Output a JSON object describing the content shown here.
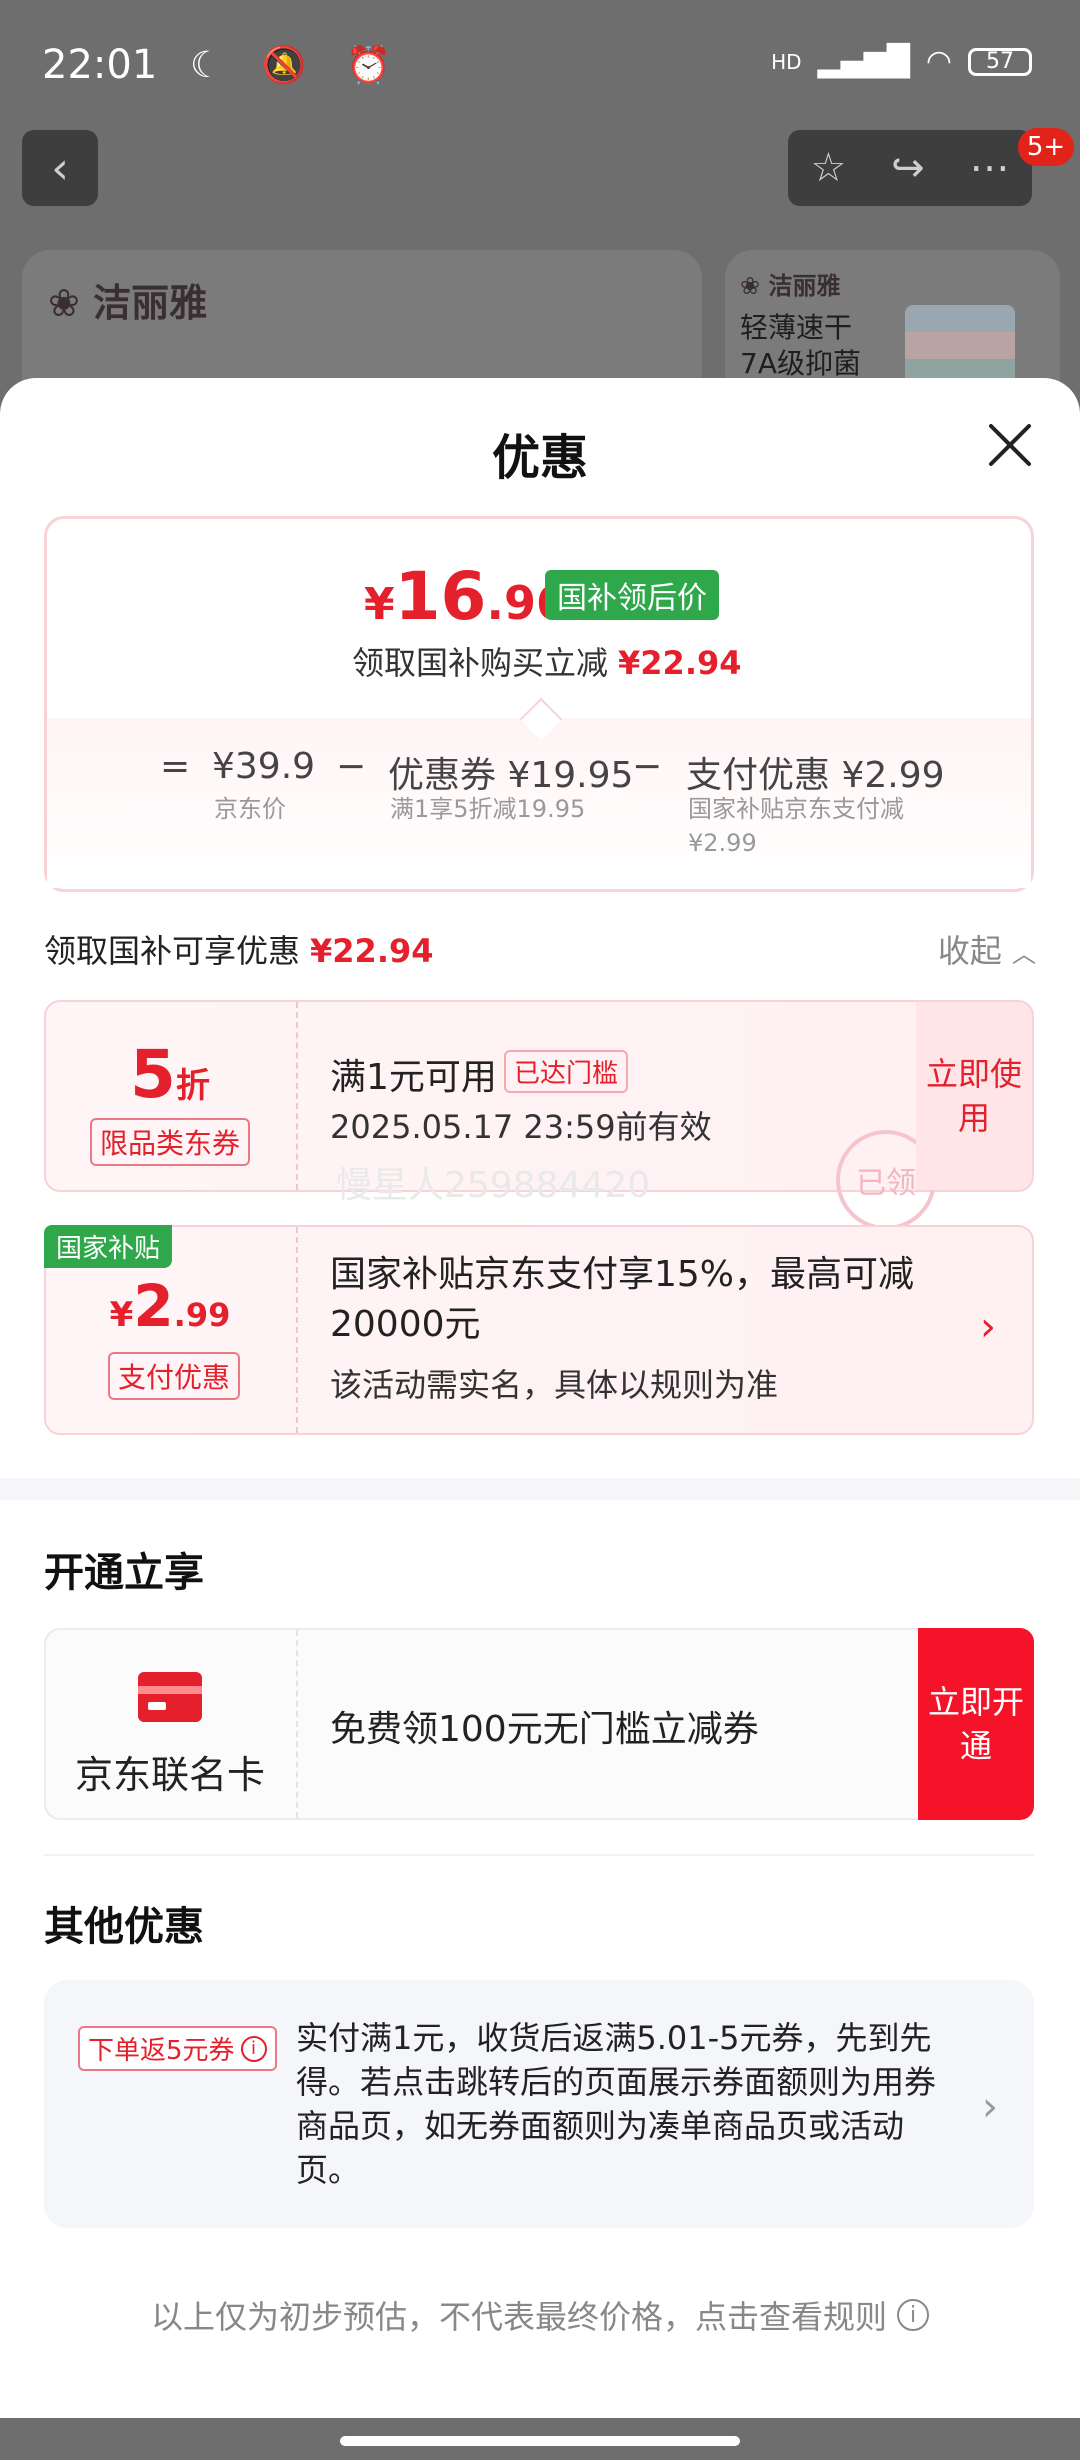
{
  "status_bar": {
    "time": "22:01",
    "left_icons": "☾ 🔕 ⏰",
    "network": "HD",
    "battery": "57"
  },
  "background": {
    "brand1": "洁丽雅",
    "brand2": "洁丽雅",
    "product_line1": "轻薄速干",
    "product_line2": "7A级抑菌",
    "badge": "5+"
  },
  "sheet": {
    "title": "优惠",
    "summary": {
      "currency": "¥",
      "price_int": "16",
      "price_dec": ".96",
      "price_tag": "国补领后价",
      "claim_text": "领取国补购买立减",
      "claim_amount": "¥22.94",
      "formula": {
        "eq": "=",
        "base_price": "¥39.9",
        "base_label": "京东价",
        "minus1": "−",
        "coupon_label": "优惠券 ¥19.95",
        "coupon_sub": "满1享5折减19.95",
        "minus2": "−",
        "pay_label": "支付优惠 ¥2.99",
        "pay_sub": "国家补贴京东支付减¥2.99"
      }
    },
    "section": {
      "title": "领取国补可享优惠",
      "amount": "¥22.94",
      "collapse": "收起"
    },
    "coupon": {
      "discount_big": "5",
      "discount_small": "折",
      "type": "限品类东券",
      "title": "满1元可用",
      "reached": "已达门槛",
      "valid": "2025.05.17 23:59前有效",
      "use_now": "立即使用",
      "stamp": "已领",
      "watermark": "慢星人259884420"
    },
    "pay_offer": {
      "tag": "国家补贴",
      "currency": "¥",
      "amount_int": "2",
      "amount_dec": ".99",
      "type": "支付优惠",
      "title": "国家补贴京东支付享15%，最高可减20000元",
      "sub": "该活动需实名，具体以规则为准"
    },
    "open_section": {
      "title": "开通立享",
      "card_name": "京东联名卡",
      "text": "免费领100元无门槛立减券",
      "button": "立即开通"
    },
    "other_section": {
      "title": "其他优惠",
      "tag": "下单返5元券",
      "text": "实付满1元，收货后返满5.01-5元券，先到先得。若点击跳转后的页面展示券面额则为用券商品页，如无券面额则为凑单商品页或活动页。"
    },
    "footer": "以上仅为初步预估，不代表最终价格，点击查看规则"
  },
  "colors": {
    "accent": "#e4202c",
    "green": "#2ea84a",
    "open_button": "#f5132a"
  }
}
